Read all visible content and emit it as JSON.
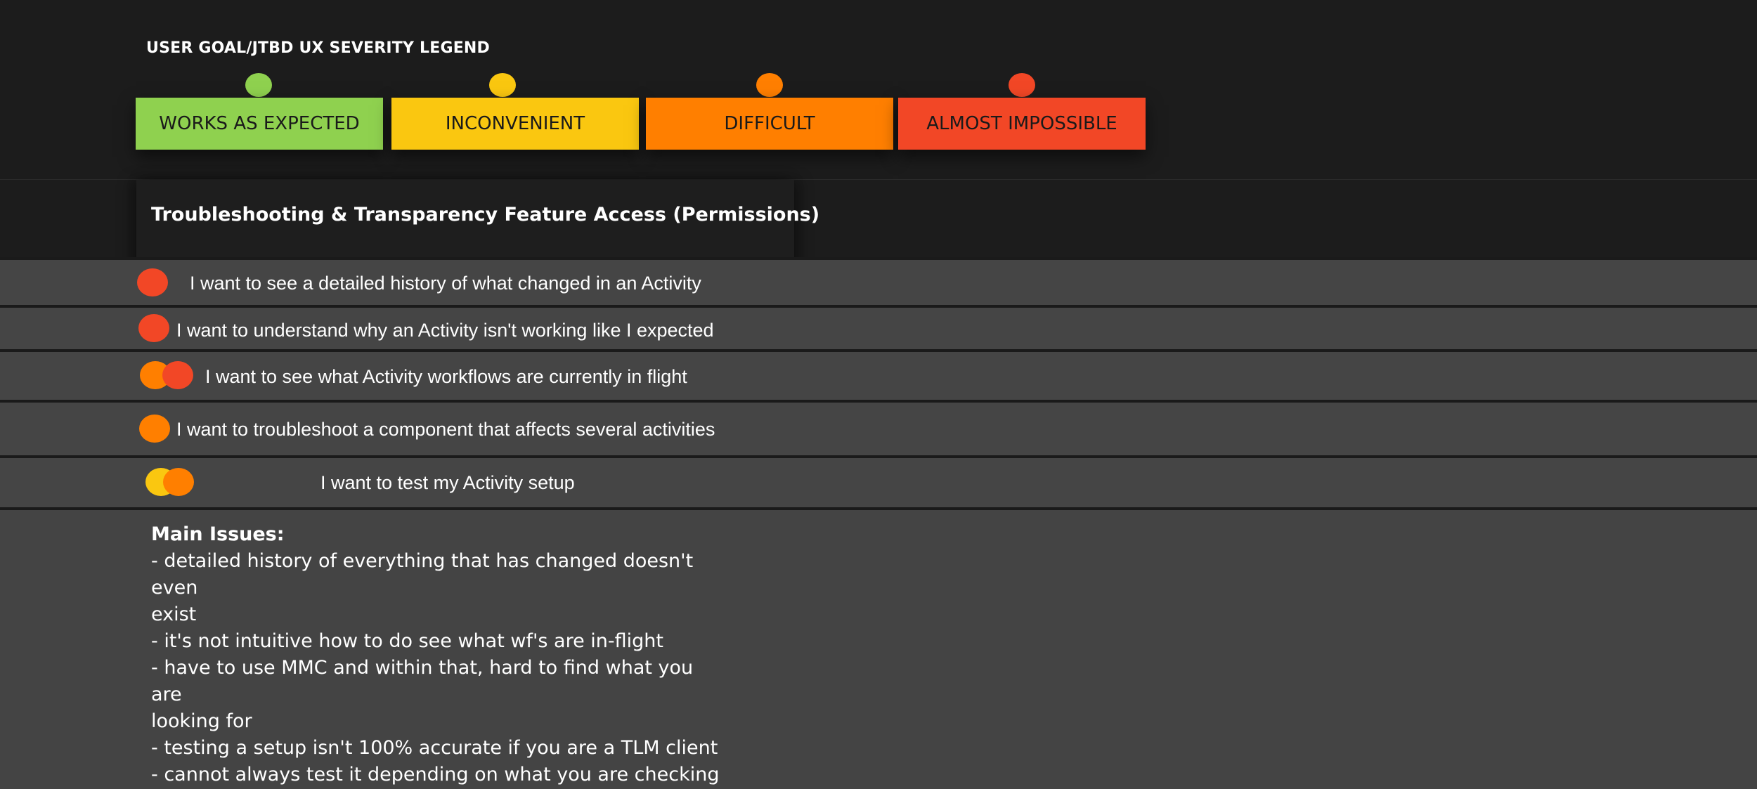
{
  "legend": {
    "title": "USER GOAL/JTBD UX SEVERITY LEGEND",
    "items": [
      {
        "label": "WORKS AS EXPECTED",
        "color": "#8fd14f"
      },
      {
        "label": "INCONVENIENT",
        "color": "#fac710"
      },
      {
        "label": "DIFFICULT",
        "color": "#ff7f00"
      },
      {
        "label": "ALMOST IMPOSSIBLE",
        "color": "#f24726"
      }
    ]
  },
  "section": {
    "title": "Troubleshooting & Transparency Feature Access (Permissions)"
  },
  "rows": [
    {
      "text": "I want to see a detailed history of what changed in an Activity",
      "severity": [
        "almost-impossible"
      ]
    },
    {
      "text": "I want to understand why an Activity isn't working like I expected",
      "severity": [
        "almost-impossible"
      ]
    },
    {
      "text": "I want to see what Activity workflows are currently in flight",
      "severity": [
        "difficult",
        "almost-impossible"
      ]
    },
    {
      "text": "I want to troubleshoot a component that affects several activities",
      "severity": [
        "difficult"
      ]
    },
    {
      "text": "I want to test my Activity setup",
      "severity": [
        "inconvenient",
        "difficult"
      ]
    }
  ],
  "issues": {
    "heading": "Main Issues:",
    "lines": [
      "- detailed history of everything that has changed doesn't even",
      "exist",
      "- it's not intuitive how to do see what wf's are in-flight",
      "- have to use MMC and within that, hard to find what you are",
      "looking for",
      "- testing a setup isn't 100% accurate if you are a TLM client",
      "- cannot always test it depending on what you are checking"
    ]
  }
}
